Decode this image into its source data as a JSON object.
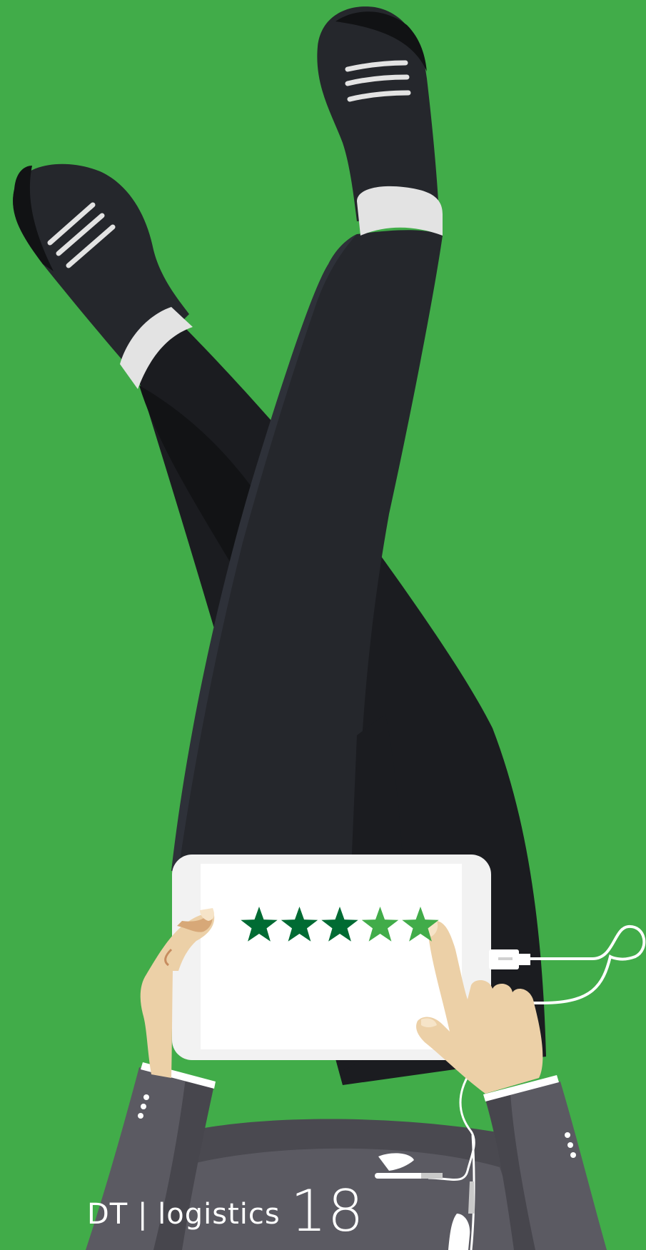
{
  "colors": {
    "background": "#41ac49",
    "pants": "#24272c",
    "pants_shadow": "#17181b",
    "sock": "#26282d",
    "sock_cuff": "#e3e3e3",
    "tablet_frame": "#f2f2f2",
    "tablet_screen": "#ffffff",
    "skin": "#ecd0a7",
    "jacket": "#5b5a62",
    "star_filled": "#006b33",
    "star_light": "#41ac49"
  },
  "rating": {
    "value": 3,
    "max": 5
  },
  "brand": {
    "name": "DT | logistics",
    "number": "18"
  },
  "icons": [
    "star-icon",
    "power-plug-icon",
    "earbuds-icon",
    "sock-stripes-icon"
  ]
}
